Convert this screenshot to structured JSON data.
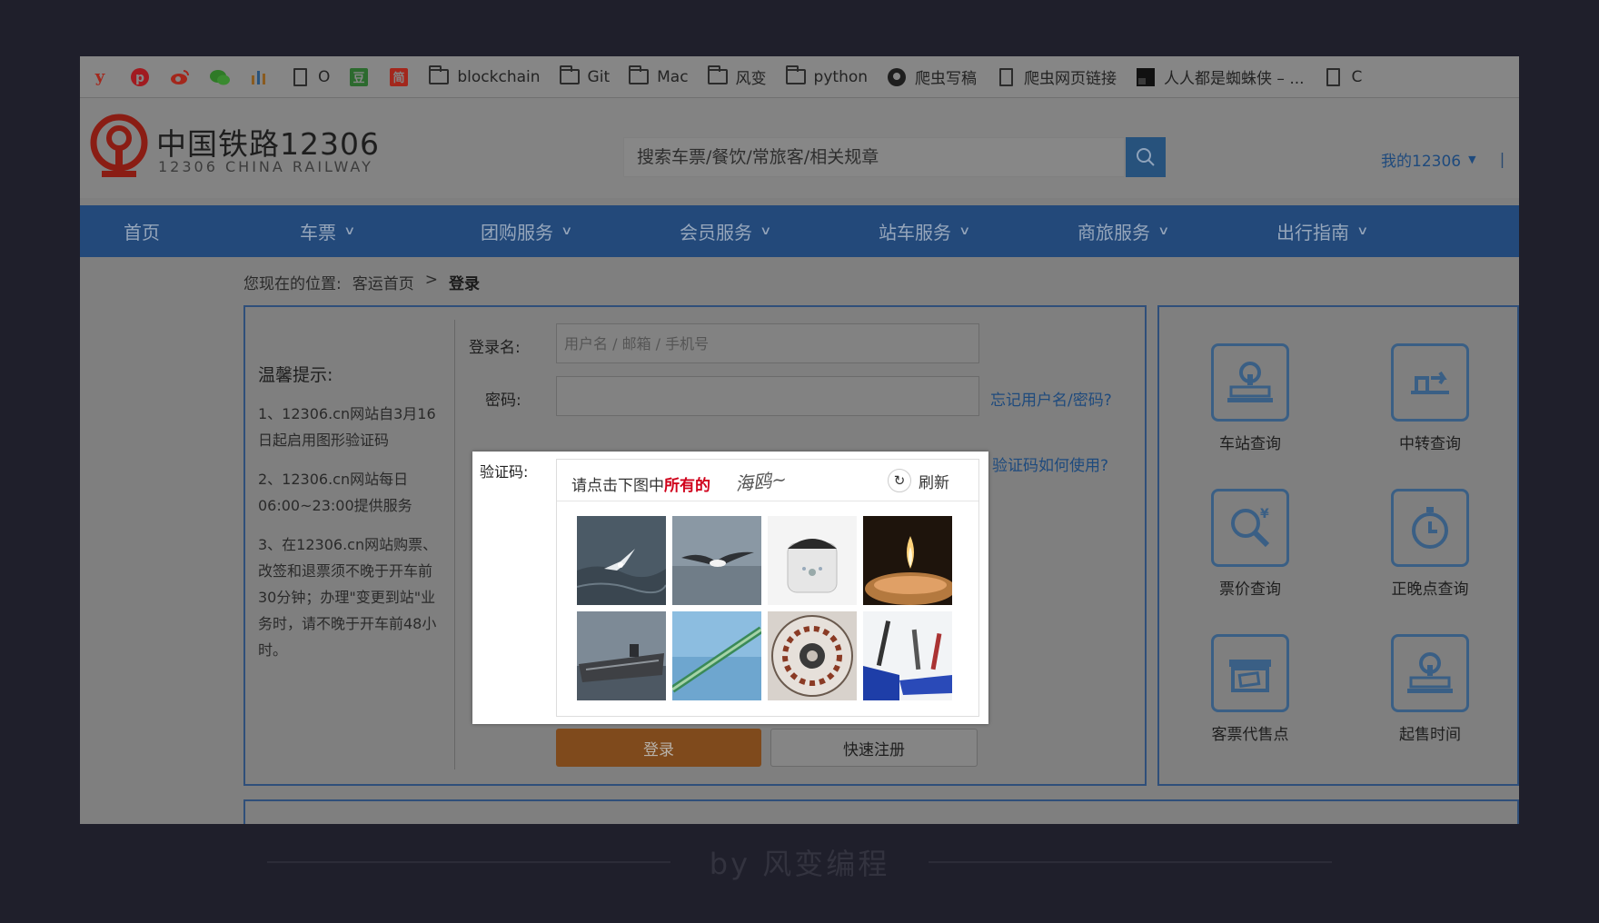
{
  "bookmarks": [
    {
      "icon": "y-icon",
      "label": "",
      "color": "#a3271c"
    },
    {
      "icon": "pinterest-icon",
      "label": "",
      "color": "#a11b20"
    },
    {
      "icon": "weibo-icon",
      "label": "",
      "color": "#a3271c"
    },
    {
      "icon": "wechat-icon",
      "label": "",
      "color": "#2f7a27"
    },
    {
      "icon": "stats-icon",
      "label": "",
      "color": "#8a5b1f"
    },
    {
      "icon": "page-icon",
      "label": "O"
    },
    {
      "icon": "douban-icon",
      "label": "",
      "color": "#2c6a2e"
    },
    {
      "icon": "jianshu-icon",
      "label": "",
      "color": "#a3271c"
    },
    {
      "icon": "folder-icon",
      "label": "blockchain"
    },
    {
      "icon": "folder-icon",
      "label": "Git"
    },
    {
      "icon": "folder-icon",
      "label": "Mac"
    },
    {
      "icon": "folder-icon",
      "label": "风变"
    },
    {
      "icon": "folder-icon",
      "label": "python"
    },
    {
      "icon": "github-icon",
      "label": "爬虫写稿"
    },
    {
      "icon": "page-icon",
      "label": "爬虫网页链接"
    },
    {
      "icon": "black-square-icon",
      "label": "人人都是蜘蛛侠 – ..."
    },
    {
      "icon": "page-icon",
      "label": "C"
    }
  ],
  "header": {
    "logo_cn": "中国铁路12306",
    "logo_en": "12306 CHINA RAILWAY",
    "search_placeholder": "搜索车票/餐饮/常旅客/相关规章",
    "my_account": "我的12306",
    "account_sep": "|"
  },
  "nav": [
    "首页",
    "车票",
    "团购服务",
    "会员服务",
    "站车服务",
    "商旅服务",
    "出行指南"
  ],
  "breadcrumb": {
    "prefix": "您现在的位置:",
    "home": "客运首页",
    "sep": ">",
    "current": "登录"
  },
  "tips": {
    "title": "温馨提示:",
    "items": [
      "1、12306.cn网站自3月16日起启用图形验证码",
      "2、12306.cn网站每日06:00~23:00提供服务",
      "3、在12306.cn网站购票、改签和退票须不晚于开车前30分钟；办理\"变更到站\"业务时，请不晚于开车前48小时。"
    ]
  },
  "form": {
    "username_label": "登录名:",
    "username_placeholder": "用户名 / 邮箱 / 手机号",
    "password_label": "密码:",
    "forgot_link": "忘记用户名/密码?",
    "captcha_label": "验证码:",
    "captcha_help_link": "验证码如何使用?",
    "login_button": "登录",
    "register_button": "快速注册"
  },
  "captcha": {
    "prompt_prefix": "请点击下图中",
    "prompt_highlight": "所有的",
    "target_word": "海鸥~",
    "refresh_label": "刷新",
    "images": [
      "seagull-sea",
      "seagull-flying",
      "rice-cooker",
      "candle",
      "aircraft-carrier",
      "cable",
      "round-pattern",
      "pens-desk"
    ]
  },
  "quick_links": [
    "车站查询",
    "中转查询",
    "票价查询",
    "正晚点查询",
    "客票代售点",
    "起售时间"
  ],
  "watermark": "by 风变编程",
  "colors": {
    "nav_bg": "#23497a",
    "accent_blue": "#1e4a7d",
    "login_orange": "#7f4a1c",
    "captcha_red": "#d0021b",
    "logo_red": "#8a1d14"
  }
}
